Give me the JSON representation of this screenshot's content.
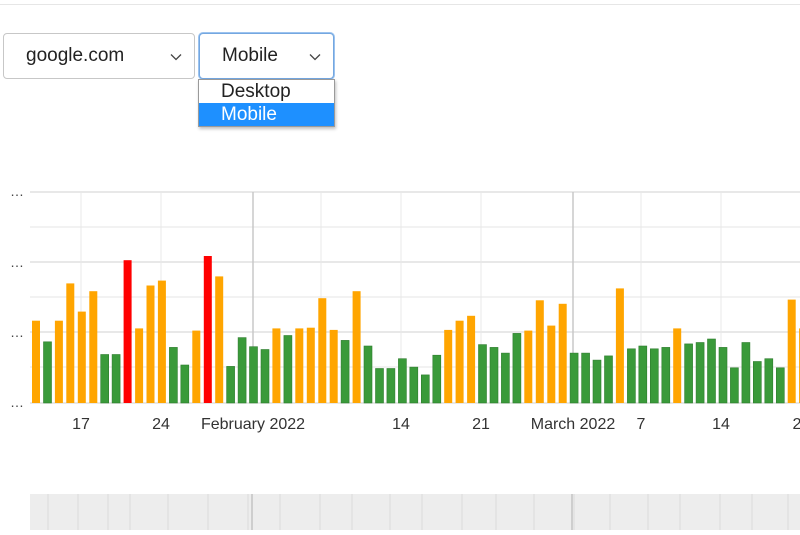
{
  "filters": {
    "domain": {
      "value": "google.com"
    },
    "device": {
      "value": "Mobile",
      "options": [
        "Desktop",
        "Mobile"
      ],
      "selected_index": 1
    }
  },
  "colors": {
    "good": "#3a9a3a",
    "needs_improvement": "#ffa500",
    "poor": "#ff0000"
  },
  "chart_data": {
    "type": "bar",
    "title": "",
    "xlabel": "",
    "ylabel": "",
    "x_tick_labels": [
      "17",
      "24",
      "February 2022",
      "14",
      "21",
      "March 2022",
      "7",
      "14",
      "2"
    ],
    "y_tick_labels": [
      "…",
      "…",
      "…",
      "…"
    ],
    "ylim": [
      0,
      3
    ],
    "grid": true,
    "values": [
      1.17,
      0.87,
      1.17,
      1.7,
      1.3,
      1.59,
      0.69,
      0.69,
      2.03,
      1.06,
      1.67,
      1.74,
      0.79,
      0.54,
      1.03,
      2.09,
      1.8,
      0.52,
      0.93,
      0.8,
      0.76,
      1.06,
      0.96,
      1.06,
      1.07,
      1.49,
      1.04,
      0.89,
      1.59,
      0.81,
      0.49,
      0.49,
      0.63,
      0.51,
      0.4,
      0.68,
      1.04,
      1.17,
      1.24,
      0.83,
      0.79,
      0.71,
      0.99,
      1.03,
      1.46,
      1.1,
      1.41,
      0.71,
      0.71,
      0.61,
      0.67,
      1.63,
      0.77,
      0.81,
      0.77,
      0.79,
      1.06,
      0.84,
      0.86,
      0.91,
      0.79,
      0.5,
      0.86,
      0.59,
      0.63,
      0.5,
      1.47,
      1.06
    ],
    "categories": [
      "ni",
      "g",
      "ni",
      "ni",
      "ni",
      "ni",
      "g",
      "g",
      "p",
      "ni",
      "ni",
      "ni",
      "g",
      "g",
      "ni",
      "p",
      "ni",
      "g",
      "g",
      "g",
      "g",
      "ni",
      "g",
      "ni",
      "ni",
      "ni",
      "ni",
      "g",
      "ni",
      "g",
      "g",
      "g",
      "g",
      "g",
      "g",
      "g",
      "ni",
      "ni",
      "ni",
      "g",
      "g",
      "g",
      "g",
      "ni",
      "ni",
      "ni",
      "ni",
      "g",
      "g",
      "g",
      "g",
      "ni",
      "g",
      "g",
      "g",
      "g",
      "ni",
      "g",
      "g",
      "g",
      "g",
      "g",
      "g",
      "g",
      "g",
      "g",
      "ni",
      "ni"
    ]
  }
}
